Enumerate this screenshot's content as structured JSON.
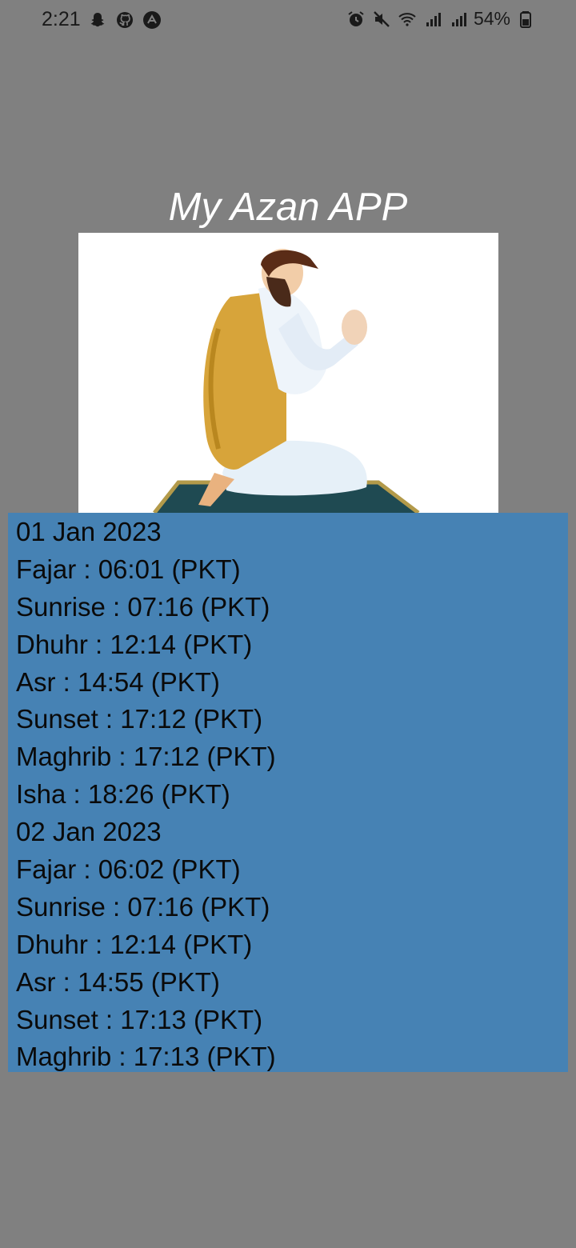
{
  "status_bar": {
    "time": "2:21",
    "left_icons": [
      "snapchat-icon",
      "github-icon",
      "app-icon"
    ],
    "right_icons": [
      "alarm-icon",
      "mute-icon",
      "wifi-icon",
      "signal-icon",
      "signal-icon"
    ],
    "battery": "54%"
  },
  "app": {
    "title": "My Azan APP"
  },
  "image": {
    "description": "man praying on prayer mat"
  },
  "prayer_list": [
    "01 Jan 2023",
    "Fajar : 06:01 (PKT)",
    "Sunrise : 07:16 (PKT)",
    "Dhuhr : 12:14 (PKT)",
    "Asr : 14:54 (PKT)",
    "Sunset : 17:12 (PKT)",
    "Maghrib : 17:12 (PKT)",
    "Isha : 18:26 (PKT)",
    "02 Jan 2023",
    "Fajar : 06:02 (PKT)",
    "Sunrise : 07:16 (PKT)",
    "Dhuhr : 12:14 (PKT)",
    "Asr : 14:55 (PKT)",
    "Sunset : 17:13 (PKT)",
    "Maghrib : 17:13 (PKT)"
  ],
  "colors": {
    "background": "#808080",
    "list_background": "#4682b4",
    "title_color": "#ffffff"
  }
}
